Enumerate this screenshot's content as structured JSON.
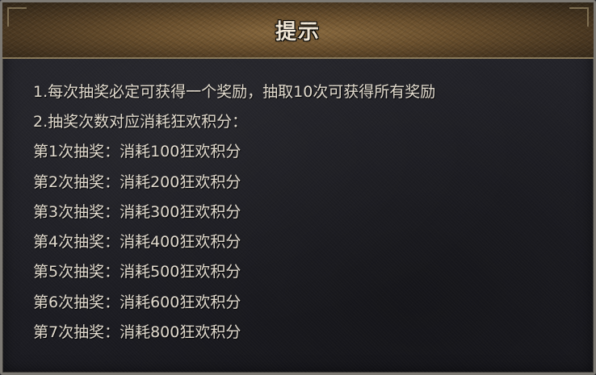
{
  "dialog": {
    "title": "提示",
    "lines": [
      "1.每次抽奖必定可获得一个奖励，抽取10次可获得所有奖励",
      "2.抽奖次数对应消耗狂欢积分：",
      "第1次抽奖：消耗100狂欢积分",
      "第2次抽奖：消耗200狂欢积分",
      "第3次抽奖：消耗300狂欢积分",
      "第4次抽奖：消耗400狂欢积分",
      "第5次抽奖：消耗500狂欢积分",
      "第6次抽奖：消耗600狂欢积分",
      "第7次抽奖：消耗800狂欢积分"
    ]
  }
}
